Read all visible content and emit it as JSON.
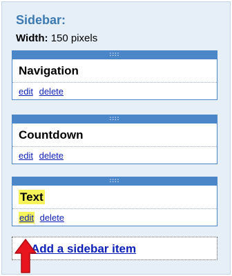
{
  "sidebar": {
    "title": "Sidebar:",
    "width_key": "Width:",
    "width_value": "150 pixels"
  },
  "widgets": [
    {
      "handle": "::::",
      "title": "Navigation",
      "edit": "edit",
      "delete": "delete",
      "highlighted": false
    },
    {
      "handle": "::::",
      "title": "Countdown",
      "edit": "edit",
      "delete": "delete",
      "highlighted": false
    },
    {
      "handle": "::::",
      "title": "Text",
      "edit": "edit",
      "delete": "delete",
      "highlighted": true
    }
  ],
  "add_item": {
    "label": "Add a sidebar item"
  },
  "colors": {
    "panel_bg": "#e6eff7",
    "accent_blue": "#4a86c8",
    "link_blue": "#0b1fb8",
    "highlight_yellow": "#f6f35a",
    "arrow_red": "#e8141e"
  },
  "icons": {
    "annotation": "red-arrow-up-icon"
  }
}
